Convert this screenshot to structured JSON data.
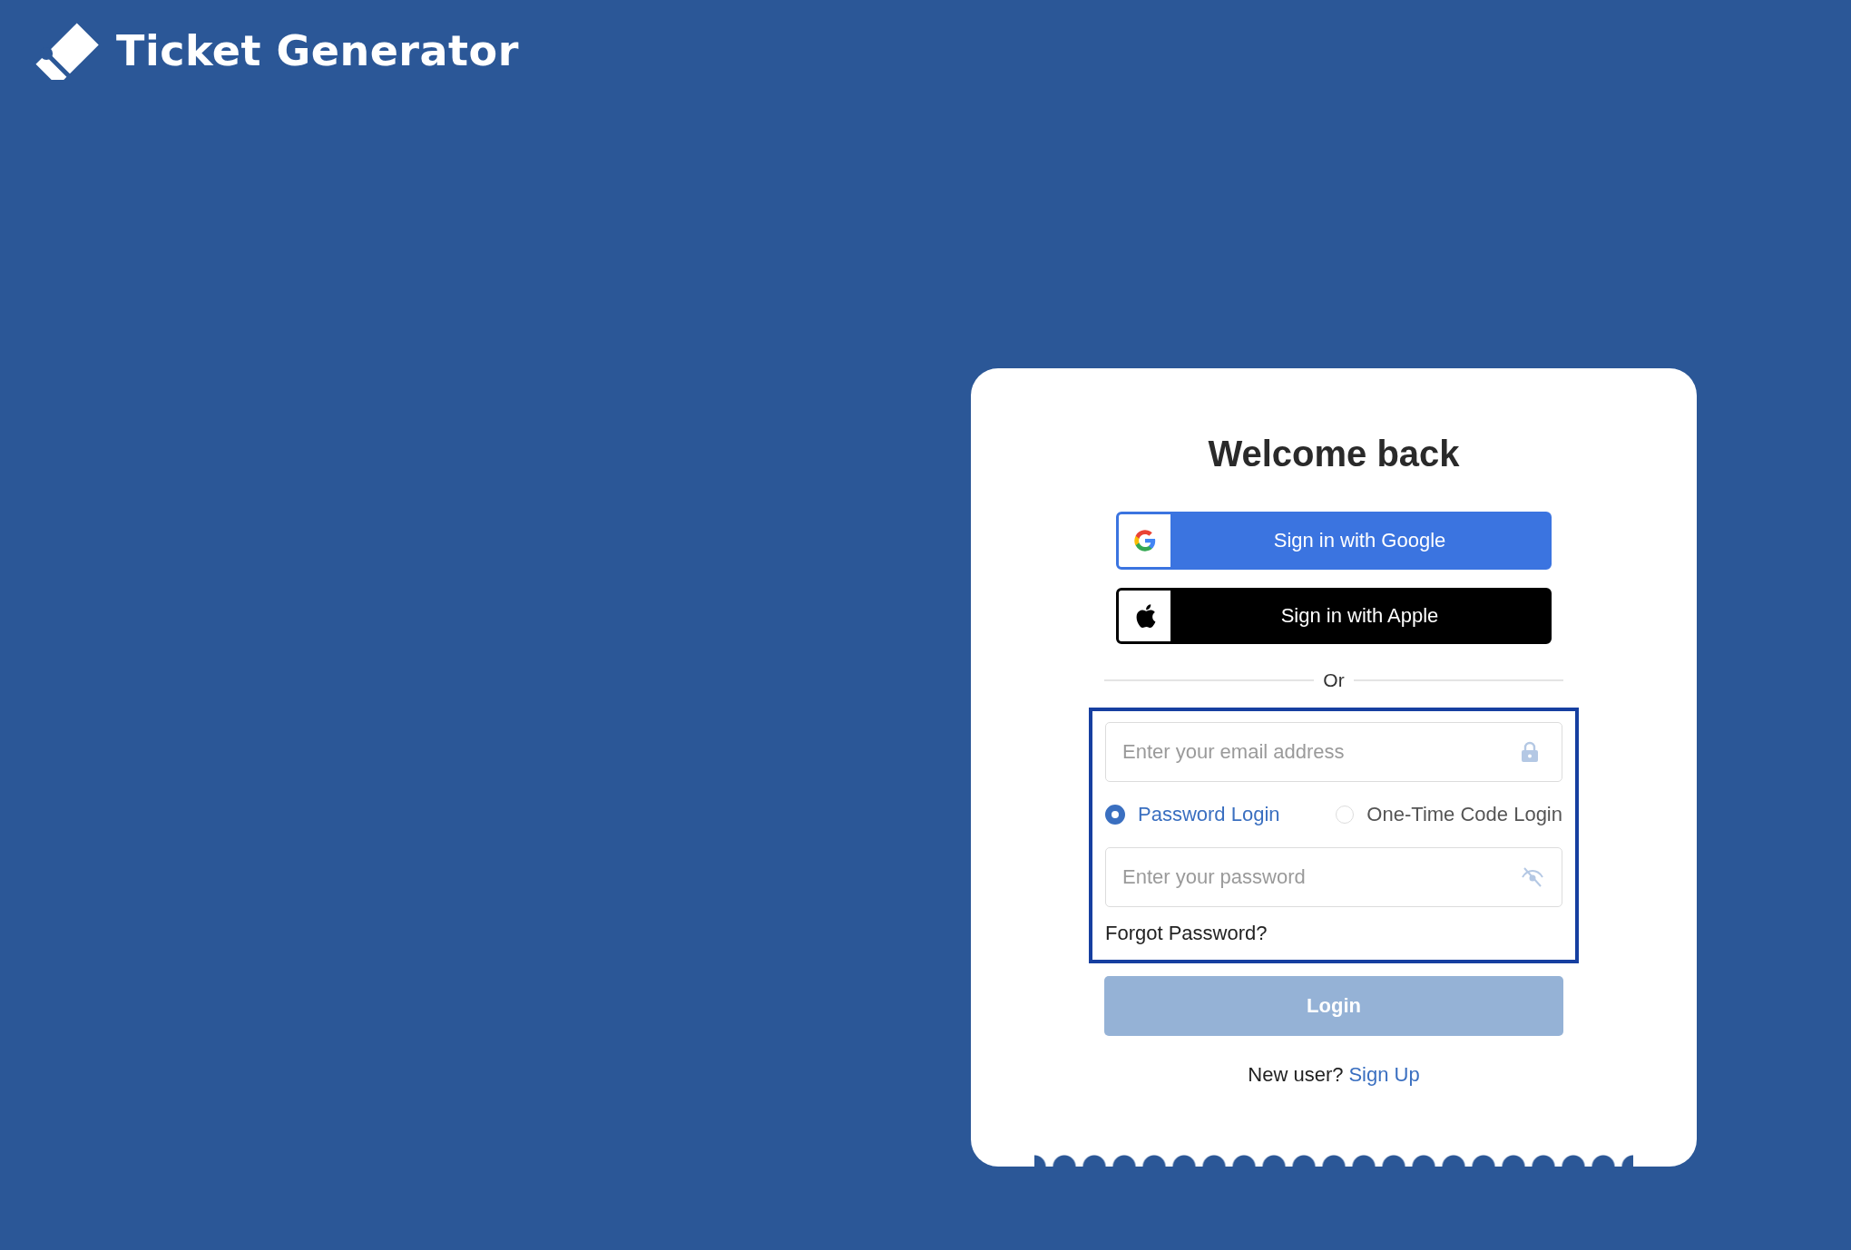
{
  "brand": {
    "name": "Ticket Generator"
  },
  "card": {
    "title": "Welcome back",
    "social_buttons": [
      {
        "kind": "google",
        "label": "Sign in with Google"
      },
      {
        "kind": "apple",
        "label": "Sign in with Apple"
      }
    ],
    "divider": "Or",
    "login_form": {
      "highlighted": true,
      "email_field": {
        "placeholder": "Enter your email address"
      },
      "login_modes": [
        {
          "label": "Password Login",
          "selected": true
        },
        {
          "label": "One-Time Code Login",
          "selected": false
        }
      ],
      "password_field": {
        "placeholder": "Enter your password"
      },
      "forgot_link": "Forgot Password?"
    },
    "login_button": {
      "label": "Login",
      "disabled": true
    },
    "signup": {
      "prompt": "New user?",
      "link": "Sign Up"
    }
  }
}
